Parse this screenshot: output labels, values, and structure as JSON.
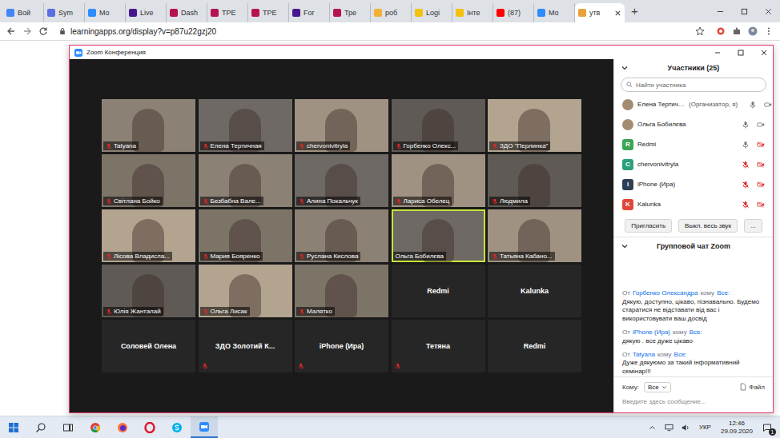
{
  "browser": {
    "tabs": [
      {
        "label": "Вой",
        "selected": false,
        "color": "#4285f4"
      },
      {
        "label": "Sym",
        "selected": false,
        "color": "#5b6ee1"
      },
      {
        "label": "Мо",
        "selected": false,
        "color": "#2d8cff"
      },
      {
        "label": "Live",
        "selected": false,
        "color": "#46178f"
      },
      {
        "label": "Dash",
        "selected": false,
        "color": "#b5124f"
      },
      {
        "label": "ТРЕ",
        "selected": false,
        "color": "#b5124f"
      },
      {
        "label": "ТРЕ",
        "selected": false,
        "color": "#b5124f"
      },
      {
        "label": "For",
        "selected": false,
        "color": "#46178f"
      },
      {
        "label": "Тре",
        "selected": false,
        "color": "#b5124f"
      },
      {
        "label": "роб",
        "selected": false,
        "color": "#f2b134"
      },
      {
        "label": "Logi",
        "selected": false,
        "color": "#f4c20d"
      },
      {
        "label": "Інте",
        "selected": false,
        "color": "#f4c20d"
      },
      {
        "label": "(87)",
        "selected": false,
        "color": "#ff0000"
      },
      {
        "label": "Мо",
        "selected": false,
        "color": "#2d8cff"
      },
      {
        "label": "утв",
        "selected": true,
        "color": "#e9a23b"
      }
    ],
    "new_tab": "+",
    "address": "learningapps.org/display?v=p87u22gzj20"
  },
  "zoom": {
    "title": "Zoom Конференция",
    "tiles": [
      {
        "name": "Tatyana",
        "kind": "video",
        "muted": true,
        "active": false
      },
      {
        "name": "Елена Тертичная",
        "kind": "video",
        "muted": true,
        "active": false
      },
      {
        "name": "chervonivitryla",
        "kind": "video",
        "muted": true,
        "active": false
      },
      {
        "name": "Горбенко Олекс...",
        "kind": "video",
        "muted": true,
        "active": false
      },
      {
        "name": "ЗДО \"Перлинка\"",
        "kind": "video",
        "muted": true,
        "active": false
      },
      {
        "name": "Світлана Бойко",
        "kind": "video",
        "muted": true,
        "active": false
      },
      {
        "name": "Безбабна Вале...",
        "kind": "video",
        "muted": true,
        "active": false
      },
      {
        "name": "Алина Покальчук",
        "kind": "video",
        "muted": true,
        "active": false
      },
      {
        "name": "Лариса Обелец",
        "kind": "video",
        "muted": true,
        "active": false
      },
      {
        "name": "Людмила",
        "kind": "video",
        "muted": true,
        "active": false
      },
      {
        "name": "Лісова Владисла...",
        "kind": "video",
        "muted": true,
        "active": false
      },
      {
        "name": "Мария Бояренко",
        "kind": "video",
        "muted": true,
        "active": false
      },
      {
        "name": "Руслана Кислова",
        "kind": "video",
        "muted": true,
        "active": false
      },
      {
        "name": "Ольга Бобилєва",
        "kind": "video",
        "muted": false,
        "active": true
      },
      {
        "name": "Татьяна Кабано...",
        "kind": "video",
        "muted": true,
        "active": false
      },
      {
        "name": "Юлія Жанталай",
        "kind": "video",
        "muted": true,
        "active": false
      },
      {
        "name": "Ольга Лисак",
        "kind": "video",
        "muted": true,
        "active": false
      },
      {
        "name": "Малятко",
        "kind": "video",
        "muted": true,
        "active": false
      },
      {
        "name": "Redmi",
        "kind": "name",
        "muted": false,
        "active": false
      },
      {
        "name": "Kalunka",
        "kind": "name",
        "muted": false,
        "active": false
      },
      {
        "name": "Соловей Олена",
        "kind": "name",
        "muted": false,
        "active": false
      },
      {
        "name": "ЗДО Золотий К...",
        "kind": "name",
        "muted": true,
        "active": false
      },
      {
        "name": "iPhone (Ира)",
        "kind": "name",
        "muted": true,
        "active": false
      },
      {
        "name": "Тетяна",
        "kind": "name",
        "muted": true,
        "active": false
      },
      {
        "name": "Redmi",
        "kind": "name",
        "muted": false,
        "active": false
      }
    ],
    "participants": {
      "header": "Участники (25)",
      "search_placeholder": "Найти участника",
      "items": [
        {
          "name": "Елена Тертич…",
          "role": "(Организатор, я)",
          "kind": "photo",
          "mic_muted": false,
          "video_off": false
        },
        {
          "name": "Ольга Бобилєва",
          "role": "",
          "kind": "photo",
          "mic_muted": false,
          "video_off": false
        },
        {
          "name": "Redmi",
          "role": "",
          "kind": "letter",
          "letter": "R",
          "color": "#3aa655",
          "mic_muted": false,
          "video_off": true
        },
        {
          "name": "chervonivitryla",
          "role": "",
          "kind": "letter",
          "letter": "C",
          "color": "#2aa17a",
          "mic_muted": true,
          "video_off": true
        },
        {
          "name": "iPhone (Ира)",
          "role": "",
          "kind": "letter",
          "letter": "I",
          "color": "#2d3e55",
          "mic_muted": true,
          "video_off": true
        },
        {
          "name": "Kalunka",
          "role": "",
          "kind": "letter",
          "letter": "K",
          "color": "#e0473b",
          "mic_muted": true,
          "video_off": true
        }
      ],
      "buttons": [
        "Пригласить",
        "Выкл. весь звук",
        "..."
      ]
    },
    "chat": {
      "header": "Групповой чат Zoom",
      "messages": [
        {
          "prefix": "От",
          "sender": "Горбенко Олександра",
          "middle": "кому",
          "recipient": "Все:",
          "text": "Дякую, доступно, цікаво, пізнавально. Будемо старатися не відставати від вас і використовувати ваш досвід"
        },
        {
          "prefix": "От",
          "sender": "iPhone (Ира)",
          "middle": "кому",
          "recipient": "Все:",
          "text": "дякую . все дуже цікаво"
        },
        {
          "prefix": "От",
          "sender": "Tatyana",
          "middle": "кому",
          "recipient": "Все:",
          "text": "Дуже дякуюмо за такий інформативний семінар!!!"
        }
      ],
      "to_label": "Кому:",
      "to_value": "Все",
      "file_button": "Файл",
      "input_placeholder": "Введите здесь сообщение..."
    }
  },
  "taskbar": {
    "apps": [
      {
        "kind": "taskview",
        "selected": false
      },
      {
        "kind": "chrome",
        "selected": false
      },
      {
        "kind": "firefox",
        "selected": false
      },
      {
        "kind": "opera",
        "selected": false
      },
      {
        "kind": "skype",
        "selected": false
      },
      {
        "kind": "zoom",
        "selected": true
      }
    ],
    "language": "УКР",
    "time": "12:46",
    "date": "29.09.2020",
    "notifications": "1"
  }
}
